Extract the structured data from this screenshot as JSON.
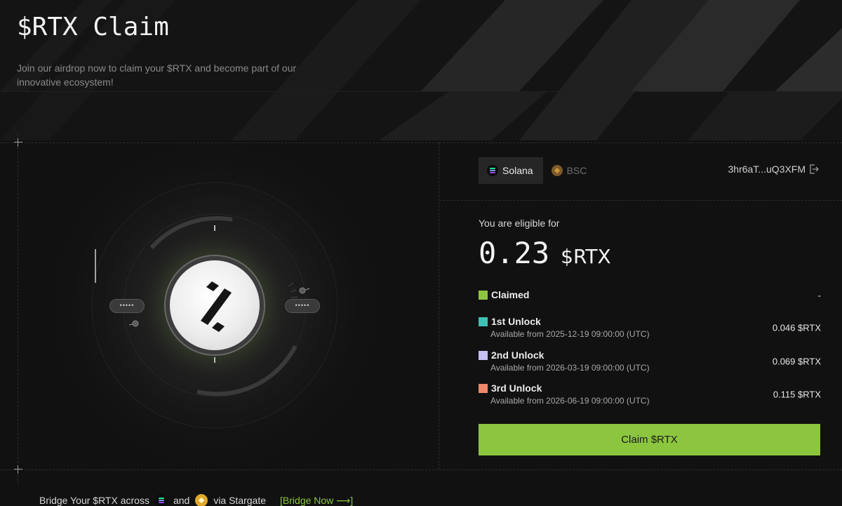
{
  "header": {
    "title": "$RTX Claim",
    "subtitle": "Join our airdrop now to claim your $RTX and become part of our innovative ecosystem!"
  },
  "visual": {
    "pill_left": "•••••",
    "pill_right": "•••••"
  },
  "network_tabs": [
    {
      "label": "Solana",
      "icon": "solana-icon",
      "active": true
    },
    {
      "label": "BSC",
      "icon": "bsc-icon",
      "active": false
    }
  ],
  "wallet": {
    "address": "3hr6aT...uQ3XFM",
    "action_icon": "logout-icon"
  },
  "eligibility": {
    "label": "You are eligible for",
    "amount": "0.23",
    "unit": "$RTX"
  },
  "schedule": [
    {
      "title": "Claimed",
      "subtitle": "",
      "value": "-",
      "color": "#8cc63f"
    },
    {
      "title": "1st Unlock",
      "subtitle": "Available from 2025-12-19 09:00:00 (UTC)",
      "value": "0.046 $RTX",
      "color": "#3ec1b4"
    },
    {
      "title": "2nd Unlock",
      "subtitle": "Available from 2026-03-19 09:00:00 (UTC)",
      "value": "0.069 $RTX",
      "color": "#c5bff2"
    },
    {
      "title": "3rd Unlock",
      "subtitle": "Available from 2026-06-19 09:00:00 (UTC)",
      "value": "0.115 $RTX",
      "color": "#f0886a"
    }
  ],
  "claim_button": {
    "label": "Claim $RTX"
  },
  "bridge": {
    "prefix": "Bridge Your $RTX across",
    "and": "and",
    "suffix": "via Stargate",
    "link": "[Bridge Now ⟶]"
  },
  "colors": {
    "accent": "#8cc63f",
    "background": "#111111"
  }
}
